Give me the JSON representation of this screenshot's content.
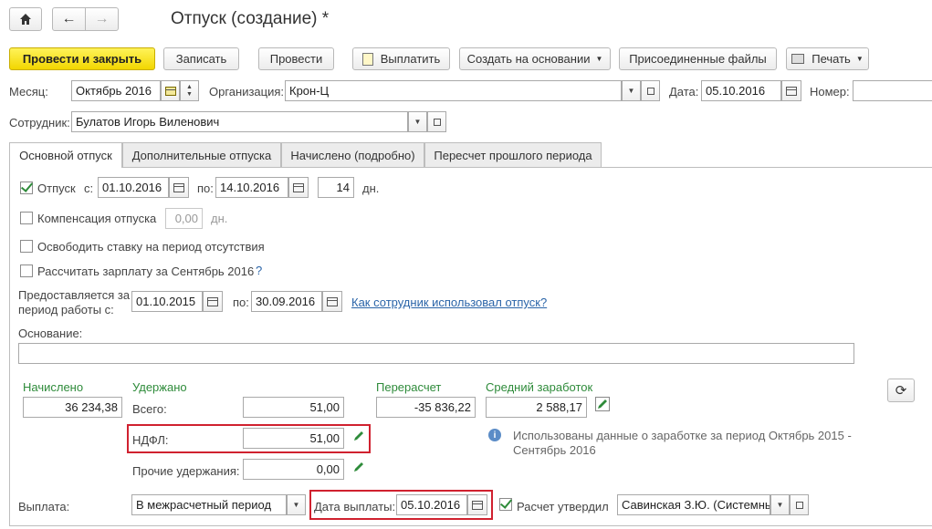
{
  "window": {
    "title": "Отпуск (создание) *"
  },
  "toolbar": {
    "post_close": "Провести и закрыть",
    "save": "Записать",
    "post": "Провести",
    "pay": "Выплатить",
    "create_based": "Создать на основании",
    "attached_files": "Присоединенные файлы",
    "print": "Печать"
  },
  "header": {
    "month_label": "Месяц:",
    "month_value": "Октябрь 2016",
    "org_label": "Организация:",
    "org_value": "Крон-Ц",
    "date_label": "Дата:",
    "date_value": "05.10.2016",
    "number_label": "Номер:",
    "number_value": "",
    "employee_label": "Сотрудник:",
    "employee_value": "Булатов Игорь Виленович"
  },
  "tabs": [
    {
      "label": "Основной отпуск"
    },
    {
      "label": "Дополнительные отпуска"
    },
    {
      "label": "Начислено (подробно)"
    },
    {
      "label": "Пересчет прошлого периода"
    }
  ],
  "vacation": {
    "label": "Отпуск",
    "from_label": "с:",
    "from_value": "01.10.2016",
    "to_label": "по:",
    "to_value": "14.10.2016",
    "days_value": "14",
    "days_unit": "дн.",
    "checked": true
  },
  "compensation": {
    "label": "Компенсация отпуска",
    "value": "0,00",
    "unit": "дн."
  },
  "release_rate": {
    "label": "Освободить ставку на период отсутствия"
  },
  "calc_salary": {
    "label": "Рассчитать зарплату за Сентябрь 2016",
    "help": "?"
  },
  "work_period": {
    "label_line1": "Предоставляется за",
    "label_line2": "период работы с:",
    "from_value": "01.10.2015",
    "to_label": "по:",
    "to_value": "30.09.2016",
    "link": "Как сотрудник использовал отпуск?"
  },
  "basis": {
    "label": "Основание:",
    "value": ""
  },
  "totals": {
    "accrued_label": "Начислено",
    "accrued_value": "36 234,38",
    "withheld_label": "Удержано",
    "total_label": "Всего:",
    "total_value": "51,00",
    "ndfl_label": "НДФЛ:",
    "ndfl_value": "51,00",
    "other_label": "Прочие удержания:",
    "other_value": "0,00",
    "recalc_label": "Перерасчет",
    "recalc_value": "-35 836,22",
    "avg_label": "Средний заработок",
    "avg_value": "2 588,17",
    "info_line1": "Использованы данные о заработке за период Октябрь 2015 -",
    "info_line2": "Сентябрь 2016"
  },
  "payment": {
    "label": "Выплата:",
    "value": "В межрасчетный период",
    "date_label": "Дата выплаты:",
    "date_value": "05.10.2016",
    "approved_label": "Расчет утвердил",
    "approved_value": "Савинская З.Ю. (Системны"
  },
  "colors": {
    "accent_green": "#2e8b3a",
    "highlight_red": "#d0212f",
    "primary_yellow": "#f2d600"
  }
}
